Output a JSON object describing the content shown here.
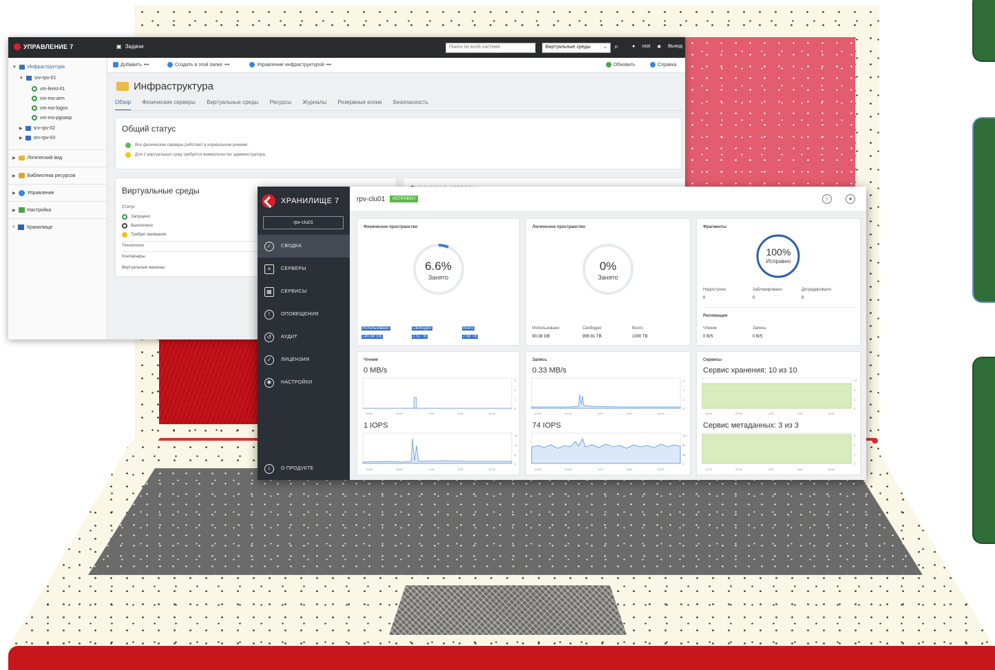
{
  "infra": {
    "brand": "УПРАВЛЕНИЕ 7",
    "tasks_label": "Задачи",
    "search_placeholder": "Поиск по всей системе",
    "env_select": "Виртуальные среды",
    "user": "root",
    "logout": "Выход",
    "tree": {
      "root": "Инфраструктура",
      "server1": "srv-rpv-01",
      "vms": [
        "vm-lirest-01",
        "vm-mo-arm",
        "vm-mo-logos",
        "vm-mo-pgsasp"
      ],
      "server2": "srv-rpv-02",
      "server3": "srv-rpv-03",
      "sections": [
        "Логический вид",
        "Библиотека ресурсов",
        "Управление",
        "Настройка",
        "Хранилище"
      ]
    },
    "toolbar": {
      "add": "Добавить",
      "create_in_folder": "Создать в этой папке",
      "manage_infra": "Управление инфраструктурой",
      "refresh": "Обновить",
      "help": "Справка"
    },
    "page_title": "Инфраструктура",
    "tabs": [
      "Обзор",
      "Физические серверы",
      "Виртуальные среды",
      "Ресурсы",
      "Журналы",
      "Резервные копии",
      "Безопасность"
    ],
    "status_card": {
      "title": "Общий статус",
      "line1": "Все физические серверы работают в нормальном режиме.",
      "line2": "Для 2 виртуальных сред требуется внимательство администратора."
    },
    "env_card": {
      "title": "Виртуальные среды",
      "status_header": "Статус",
      "statuses": [
        "Запущено",
        "Выключено",
        "Требует внимания"
      ],
      "tech_header": "Технологии",
      "tech_items": [
        "Контейнеры",
        "Виртуальные машины"
      ]
    },
    "phys_card_title": "Физические серверы"
  },
  "storage": {
    "brand": "ХРАНИЛИЩЕ 7",
    "cluster_select": "rpv-clu01",
    "nav": [
      "СВОДКА",
      "СЕРВЕРЫ",
      "СЕРВИСЫ",
      "ОПОВЕЩЕНИЯ",
      "АУДИТ",
      "ЛИЦЕНЗИЯ",
      "НАСТРОЙКИ"
    ],
    "about": "О ПРОДУКТЕ",
    "cluster_name": "rpv-clu01",
    "health_badge": "ИСПРАВЕН",
    "physical": {
      "title": "Физическое пространство",
      "percent": "6.6%",
      "percent_value": 6.6,
      "caption": "Занято",
      "labels": [
        "Использовано",
        "Свободно",
        "Всего"
      ],
      "values": [
        "180.84 GB",
        "2.51 TB",
        "2.68 TB"
      ]
    },
    "logical": {
      "title": "Логическое пространство",
      "percent": "0%",
      "percent_value": 0,
      "caption": "Занято",
      "labels": [
        "Использовано",
        "Свободно",
        "Всего"
      ],
      "values": [
        "90.08 GB",
        "999.91 TB",
        "1000 TB"
      ]
    },
    "fragments": {
      "title": "Фрагменты",
      "percent": "100%",
      "percent_value": 100,
      "caption": "Исправно",
      "labels": [
        "Недоступно",
        "Заблокировано",
        "Деградировало"
      ],
      "values": [
        "0",
        "0",
        "0"
      ],
      "replication_title": "Репликация",
      "replication_labels": [
        "Чтение",
        "Запись"
      ],
      "replication_values": [
        "0 B/S",
        "0 B/S"
      ]
    },
    "read": {
      "title": "Чтение",
      "throughput": "0 MB/s",
      "iops": "1 IOPS"
    },
    "write": {
      "title": "Запись",
      "throughput": "0.33 MB/s",
      "iops": "74 IOPS"
    },
    "services": {
      "title": "Сервисы",
      "storage": "Сервис хранения: 10 из 10",
      "metadata": "Сервис метаданных: 3 из 3"
    },
    "time_ticks": [
      "19:00",
      "23:00",
      "4:00",
      "3:00",
      "14:00"
    ],
    "chart_ticks_small": [
      "0",
      "1",
      "2",
      "3"
    ],
    "chart_ticks_iops": [
      "0",
      "5",
      "10",
      "15"
    ],
    "chart_ticks_write_iops": [
      "0",
      "40",
      "80",
      "120"
    ],
    "chart_ticks_svc": [
      "0",
      "4",
      "8",
      "12"
    ],
    "colors": {
      "line": "#5b8fd6",
      "fill": "#dbe8f7",
      "svc": "#d9ecbd",
      "healthy": "#59b947",
      "selection": "#2a69c9"
    }
  }
}
